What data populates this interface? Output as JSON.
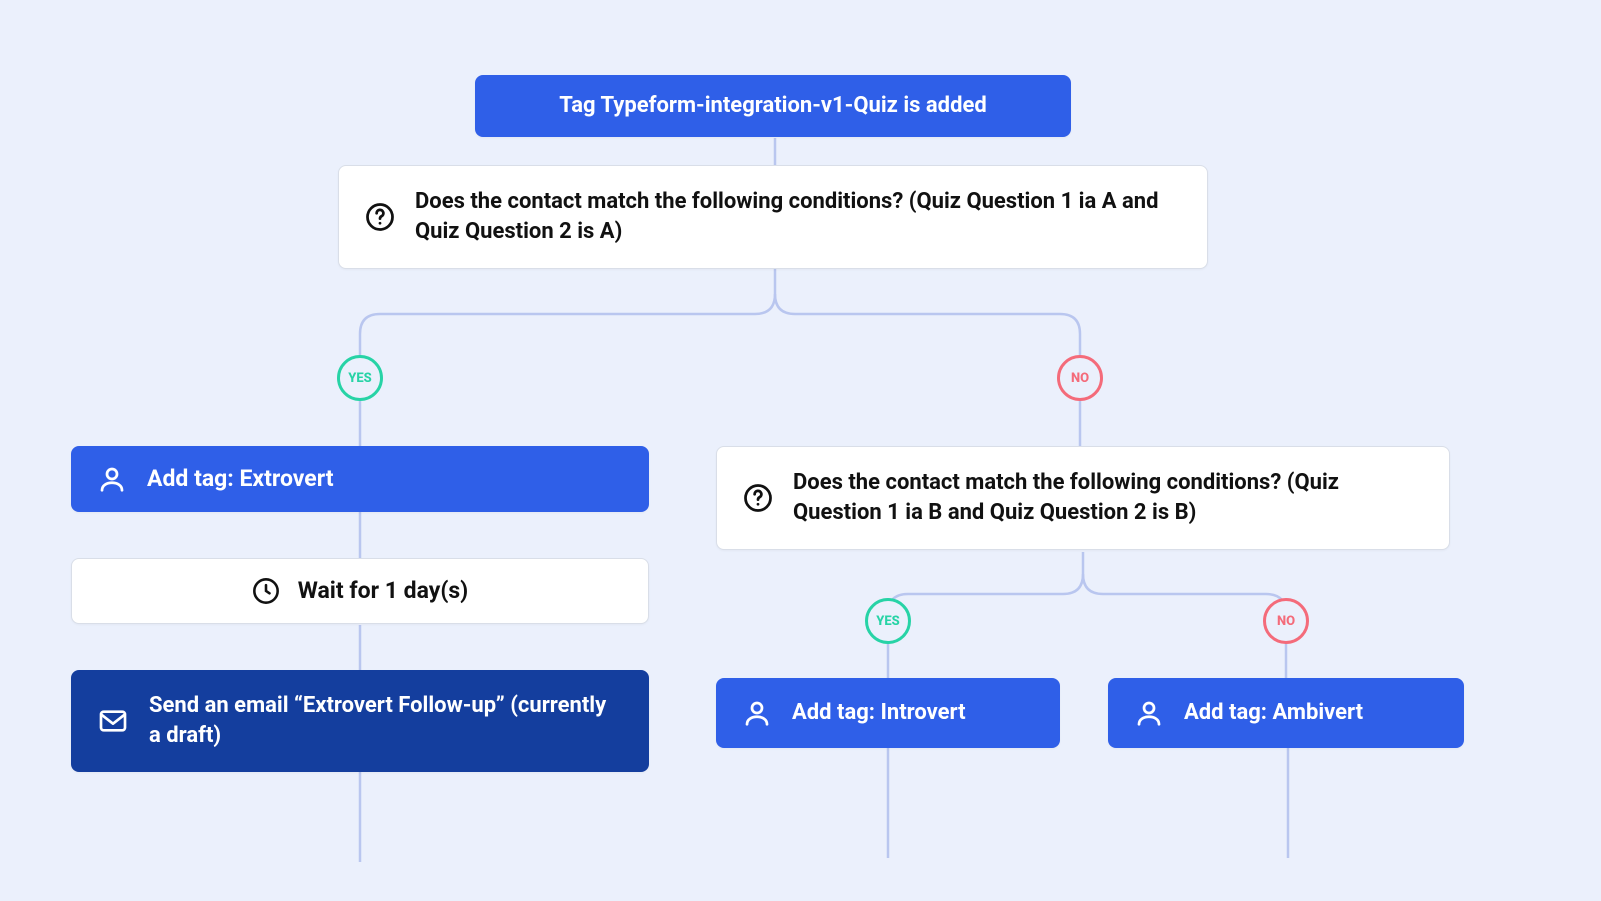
{
  "colors": {
    "bg": "#ebf0fc",
    "blue": "#2f5fe8",
    "darkblue": "#143e9e",
    "stroke": "#b9c6ef",
    "yes": "#27d3a6",
    "no": "#f46b7a"
  },
  "labels": {
    "yes": "YES",
    "no": "NO"
  },
  "nodes": {
    "trigger": {
      "text": "Tag Typeform-integration-v1-Quiz is added"
    },
    "cond1": {
      "icon": "question-icon",
      "text": "Does the contact match the following conditions? (Quiz Question 1 ia A and Quiz Question 2 is A)"
    },
    "addExtrovert": {
      "icon": "person-icon",
      "text": "Add tag: Extrovert"
    },
    "wait1": {
      "icon": "clock-icon",
      "text": "Wait for 1 day(s)"
    },
    "email1": {
      "icon": "envelope-icon",
      "text": "Send an email “Extrovert Follow-up” (currently a draft)"
    },
    "cond2": {
      "icon": "question-icon",
      "text": "Does the contact match the following conditions? (Quiz Question 1 ia B and Quiz Question 2 is B)"
    },
    "addIntrovert": {
      "icon": "person-icon",
      "text": "Add tag: Introvert"
    },
    "addAmbivert": {
      "icon": "person-icon",
      "text": "Add tag: Ambivert"
    }
  }
}
